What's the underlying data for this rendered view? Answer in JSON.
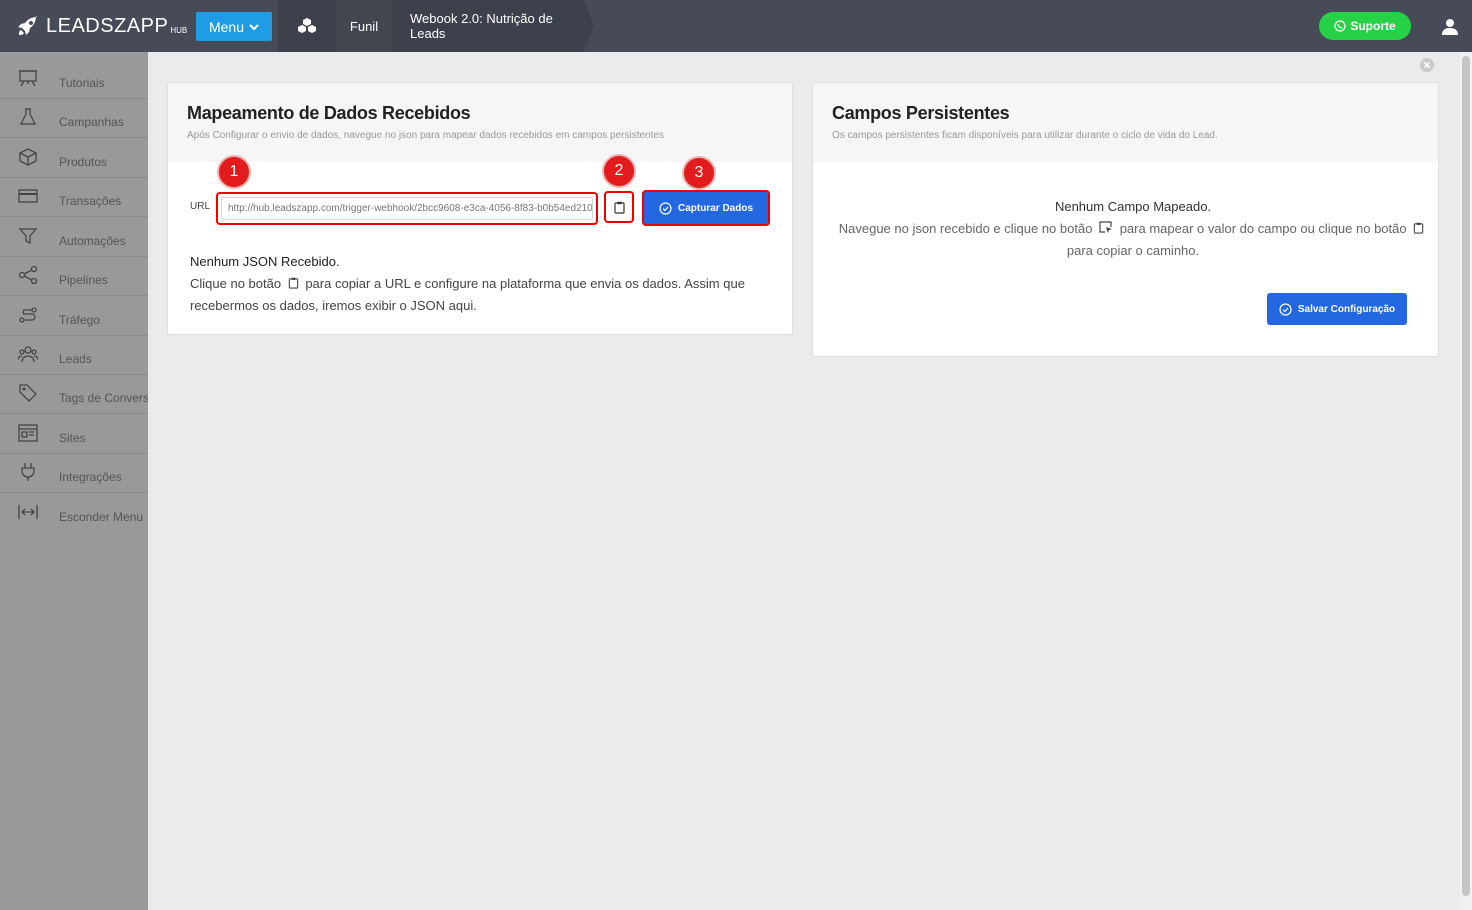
{
  "header": {
    "logo_text": "LEADSZAPP",
    "logo_suffix": "HUB",
    "menu_label": "Menu",
    "breadcrumb": {
      "funnel": "Funil",
      "page": "Webook 2.0: Nutrição de Leads"
    },
    "support_label": "Suporte"
  },
  "sidebar": {
    "items": [
      {
        "label": "Tutoriais",
        "icon": "presentation-icon"
      },
      {
        "label": "Campanhas",
        "icon": "flask-icon"
      },
      {
        "label": "Produtos",
        "icon": "box-icon"
      },
      {
        "label": "Transações",
        "icon": "credit-card-icon"
      },
      {
        "label": "Automações",
        "icon": "filter-icon"
      },
      {
        "label": "Pipelines",
        "icon": "share-nodes-icon"
      },
      {
        "label": "Tráfego",
        "icon": "route-icon"
      },
      {
        "label": "Leads",
        "icon": "users-icon"
      },
      {
        "label": "Tags de Conversão",
        "icon": "tags-icon"
      },
      {
        "label": "Sites",
        "icon": "browser-window-icon"
      },
      {
        "label": "Integrações",
        "icon": "plug-icon"
      },
      {
        "label": "Esconder Menu",
        "icon": "collapse-horizontal-icon"
      }
    ]
  },
  "mapping_card": {
    "title": "Mapeamento de Dados Recebidos",
    "subtitle": "Após Configurar o envio de dados, navegue no json para mapear dados recebidos em campos persistentes",
    "url_label": "URL",
    "url_value": "http://hub.leadszapp.com/trigger-webhook/2bcc9608-e3ca-4056-8f83-b0b54ed210",
    "capture_label": "Capturar Dados",
    "empty_title": "Nenhum JSON Recebido.",
    "empty_text_1": "Clique no botão",
    "empty_text_2": "para copiar a URL e configure na plataforma que envia os dados. Assim que recebermos os dados, iremos exibir o JSON aqui.",
    "badges": [
      "1",
      "2",
      "3"
    ]
  },
  "persistent_card": {
    "title": "Campos Persistentes",
    "subtitle": "Os campos persistentes ficam disponíveis para utilizar durante o ciclo de vida do Lead.",
    "empty_title": "Nenhum Campo Mapeado.",
    "text_1": "Navegue no json recebido e clique no botão",
    "text_2": "para mapear o valor do campo ou clique no botão",
    "text_3": "para copiar o caminho.",
    "save_label": "Salvar Configuração"
  },
  "colors": {
    "topbar": "#474b57",
    "menu_button": "#1f9ce4",
    "support_button": "#27d146",
    "primary_button": "#2368e1",
    "highlight": "#e00000",
    "sidebar": "#999999"
  }
}
